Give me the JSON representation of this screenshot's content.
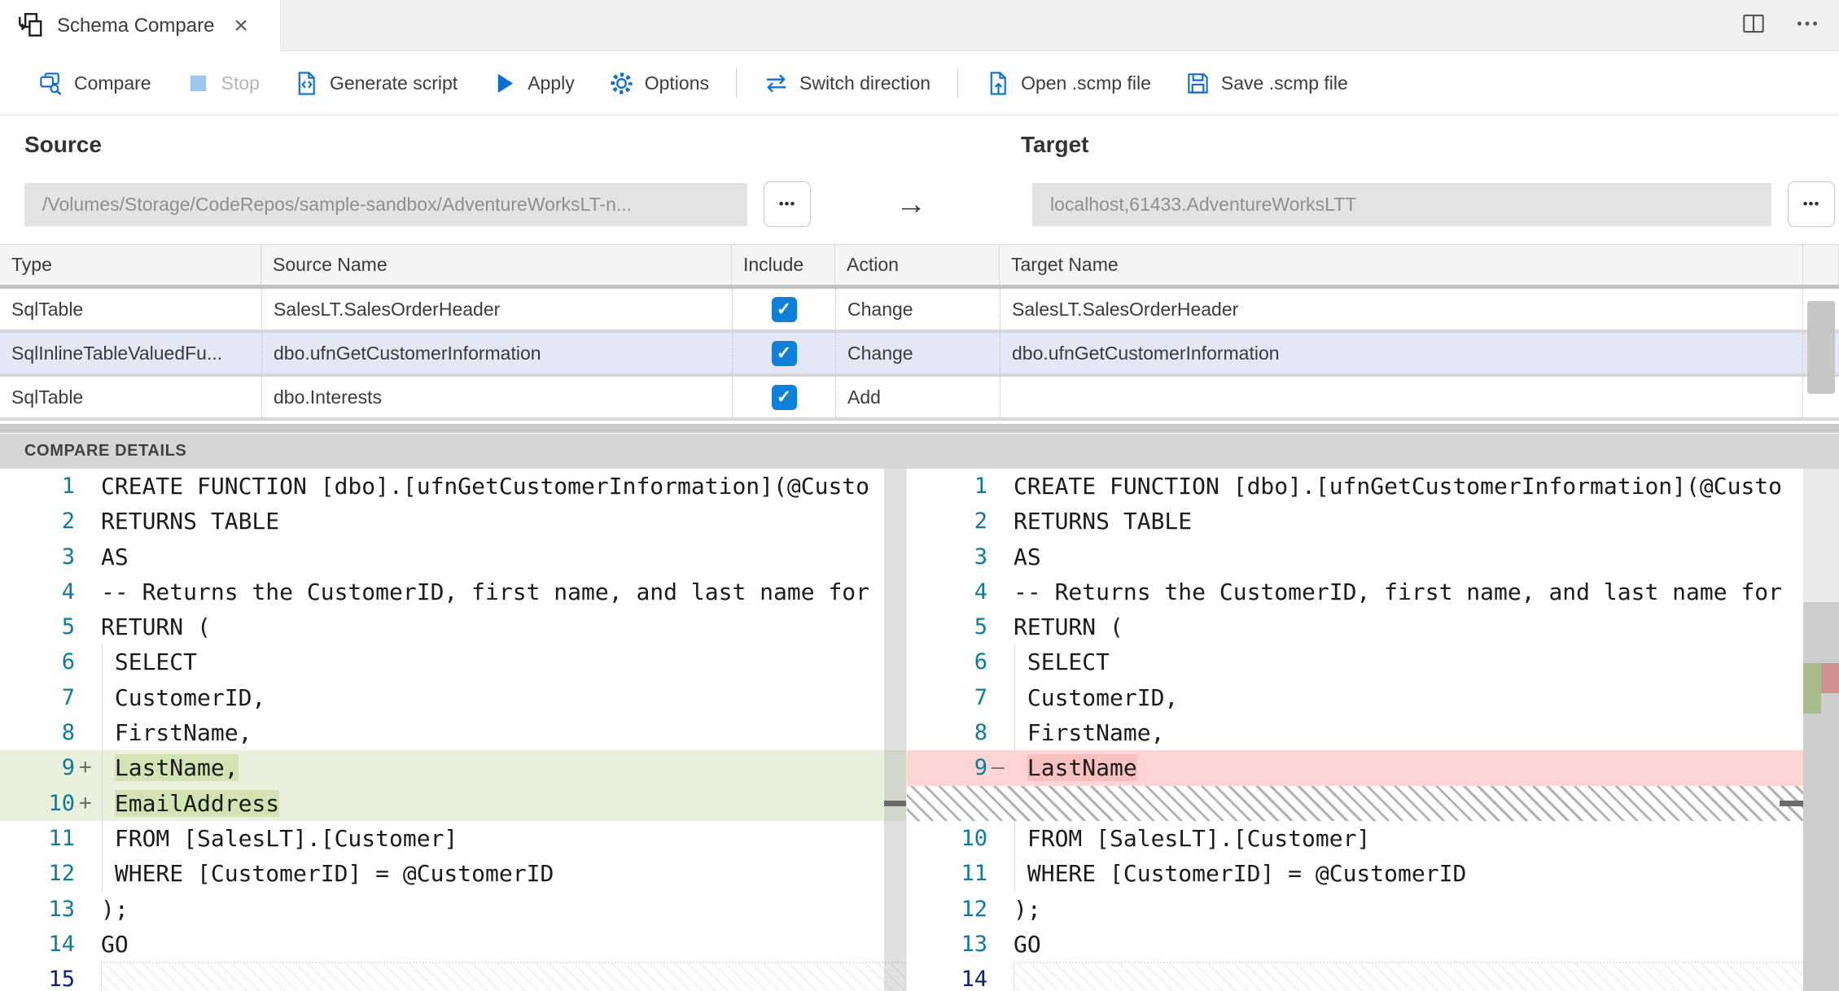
{
  "window": {
    "tab_title": "Schema Compare",
    "tab_close": "×"
  },
  "toolbar": {
    "groups": [
      [
        {
          "id": "compare",
          "label": "Compare",
          "icon": "compare-icon",
          "disabled": false
        },
        {
          "id": "stop",
          "label": "Stop",
          "icon": "stop-icon",
          "disabled": true
        },
        {
          "id": "generate-script",
          "label": "Generate script",
          "icon": "generate-script-icon",
          "disabled": false
        },
        {
          "id": "apply",
          "label": "Apply",
          "icon": "apply-icon",
          "disabled": false
        },
        {
          "id": "options",
          "label": "Options",
          "icon": "options-icon",
          "disabled": false
        }
      ],
      [
        {
          "id": "switch-direction",
          "label": "Switch direction",
          "icon": "switch-direction-icon",
          "disabled": false
        }
      ],
      [
        {
          "id": "open-scmp",
          "label": "Open .scmp file",
          "icon": "open-file-icon",
          "disabled": false
        },
        {
          "id": "save-scmp",
          "label": "Save .scmp file",
          "icon": "save-file-icon",
          "disabled": false
        }
      ]
    ]
  },
  "source": {
    "label": "Source",
    "path": "/Volumes/Storage/CodeRepos/sample-sandbox/AdventureWorksLT-n...",
    "browse_label": "•••"
  },
  "target": {
    "label": "Target",
    "path": "localhost,61433.AdventureWorksLTT",
    "browse_label": "•••"
  },
  "direction_arrow": "→",
  "grid": {
    "headers": [
      "Type",
      "Source Name",
      "Include",
      "Action",
      "Target Name"
    ],
    "rows": [
      {
        "type": "SqlTable",
        "source_name": "SalesLT.SalesOrderHeader",
        "include": true,
        "action": "Change",
        "target_name": "SalesLT.SalesOrderHeader",
        "selected": false
      },
      {
        "type": "SqlInlineTableValuedFu...",
        "source_name": "dbo.ufnGetCustomerInformation",
        "include": true,
        "action": "Change",
        "target_name": "dbo.ufnGetCustomerInformation",
        "selected": true
      },
      {
        "type": "SqlTable",
        "source_name": "dbo.Interests",
        "include": true,
        "action": "Add",
        "target_name": "",
        "selected": false
      }
    ],
    "checkmark": "✓"
  },
  "details": {
    "title": "COMPARE DETAILS"
  },
  "diff": {
    "left": {
      "lines": [
        {
          "n": "1",
          "text": "CREATE FUNCTION [dbo].[ufnGetCustomerInformation](@Custo",
          "kind": "code"
        },
        {
          "n": "2",
          "text": "RETURNS TABLE",
          "kind": "code"
        },
        {
          "n": "3",
          "text": "AS",
          "kind": "code"
        },
        {
          "n": "4",
          "text": "-- Returns the CustomerID, first name, and last name for",
          "kind": "code"
        },
        {
          "n": "5",
          "text": "RETURN (",
          "kind": "code"
        },
        {
          "n": "6",
          "text": " SELECT",
          "kind": "code",
          "guide": true
        },
        {
          "n": "7",
          "text": " CustomerID,",
          "kind": "code",
          "guide": true
        },
        {
          "n": "8",
          "text": " FirstName,",
          "kind": "code",
          "guide": true
        },
        {
          "n": "9",
          "marker": "+",
          "pre": " ",
          "hl": "LastName,",
          "kind": "added",
          "guide": true
        },
        {
          "n": "10",
          "marker": "+",
          "pre": " ",
          "hl": "EmailAddress",
          "kind": "added",
          "guide": true
        },
        {
          "n": "11",
          "text": " FROM [SalesLT].[Customer]",
          "kind": "code",
          "guide": true
        },
        {
          "n": "12",
          "text": " WHERE [CustomerID] = @CustomerID",
          "kind": "code",
          "guide": true
        },
        {
          "n": "13",
          "text": ");",
          "kind": "code"
        },
        {
          "n": "14",
          "text": "GO",
          "kind": "code"
        },
        {
          "n": "15",
          "text": "",
          "kind": "last"
        }
      ]
    },
    "right": {
      "lines": [
        {
          "n": "1",
          "text": "CREATE FUNCTION [dbo].[ufnGetCustomerInformation](@Custo",
          "kind": "code"
        },
        {
          "n": "2",
          "text": "RETURNS TABLE",
          "kind": "code"
        },
        {
          "n": "3",
          "text": "AS",
          "kind": "code"
        },
        {
          "n": "4",
          "text": "-- Returns the CustomerID, first name, and last name for",
          "kind": "code"
        },
        {
          "n": "5",
          "text": "RETURN (",
          "kind": "code"
        },
        {
          "n": "6",
          "text": " SELECT",
          "kind": "code",
          "guide": true
        },
        {
          "n": "7",
          "text": " CustomerID,",
          "kind": "code",
          "guide": true
        },
        {
          "n": "8",
          "text": " FirstName,",
          "kind": "code",
          "guide": true
        },
        {
          "n": "9",
          "marker": "–",
          "pre": " ",
          "hl": "LastName",
          "kind": "removed"
        },
        {
          "kind": "hatch"
        },
        {
          "n": "10",
          "text": " FROM [SalesLT].[Customer]",
          "kind": "code",
          "guide": true
        },
        {
          "n": "11",
          "text": " WHERE [CustomerID] = @CustomerID",
          "kind": "code",
          "guide": true
        },
        {
          "n": "12",
          "text": ");",
          "kind": "code"
        },
        {
          "n": "13",
          "text": "GO",
          "kind": "code"
        },
        {
          "n": "14",
          "text": "",
          "kind": "last"
        }
      ]
    }
  },
  "colors": {
    "accent_blue": "#0c6fce",
    "checkbox_blue": "#0f7fd7",
    "added_line_bg": "#e9f1dd",
    "added_word_bg": "#d2e4b4",
    "removed_line_bg": "#fdd5d5",
    "removed_word_bg": "#f9c2c2",
    "selected_row_bg": "#e4e7f5",
    "line_number": "#0e7b9d",
    "active_line_number": "#0b216f",
    "splitter_bg": "#d5d5d5"
  }
}
